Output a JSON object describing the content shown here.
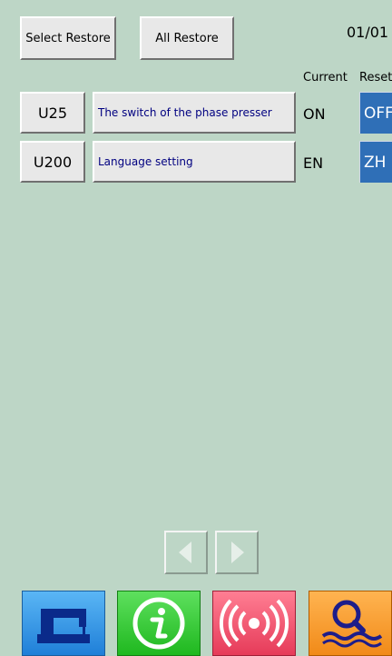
{
  "toolbar": {
    "select_restore": "Select Restore",
    "all_restore": "All Restore"
  },
  "page_indicator": "01/01",
  "columns": {
    "current": "Current",
    "reset": "Reset"
  },
  "rows": [
    {
      "code": "U25",
      "name": "The switch of the phase presser",
      "current": "ON",
      "reset": "OFF"
    },
    {
      "code": "U200",
      "name": "Language setting",
      "current": "EN",
      "reset": "ZH"
    }
  ],
  "dock": {
    "icons": [
      "sewing-machine-icon",
      "info-icon",
      "signal-icon",
      "search-icon"
    ]
  }
}
